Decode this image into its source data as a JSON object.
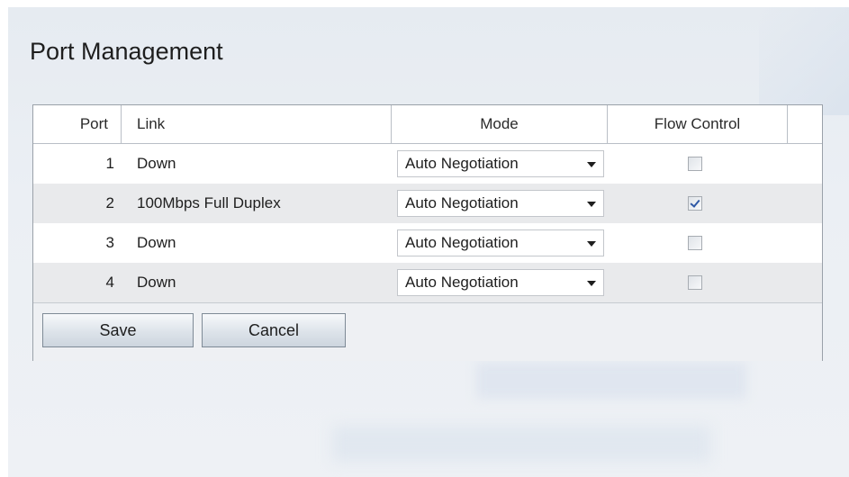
{
  "page": {
    "title": "Port Management"
  },
  "table": {
    "headers": [
      "Port",
      "Link",
      "Mode",
      "Flow Control"
    ],
    "rows": [
      {
        "port": "1",
        "link": "Down",
        "mode": "Auto Negotiation",
        "flow_control": false
      },
      {
        "port": "2",
        "link": "100Mbps Full Duplex",
        "mode": "Auto Negotiation",
        "flow_control": true
      },
      {
        "port": "3",
        "link": "Down",
        "mode": "Auto Negotiation",
        "flow_control": false
      },
      {
        "port": "4",
        "link": "Down",
        "mode": "Auto Negotiation",
        "flow_control": false
      }
    ]
  },
  "buttons": {
    "save": "Save",
    "cancel": "Cancel"
  },
  "colors": {
    "background": "#e9edf2",
    "alt_row": "#e9eaec",
    "check_accent": "#2e58a6"
  },
  "icons": {
    "dropdown": "chevron-down-icon",
    "checkbox": "checkbox-icon"
  }
}
